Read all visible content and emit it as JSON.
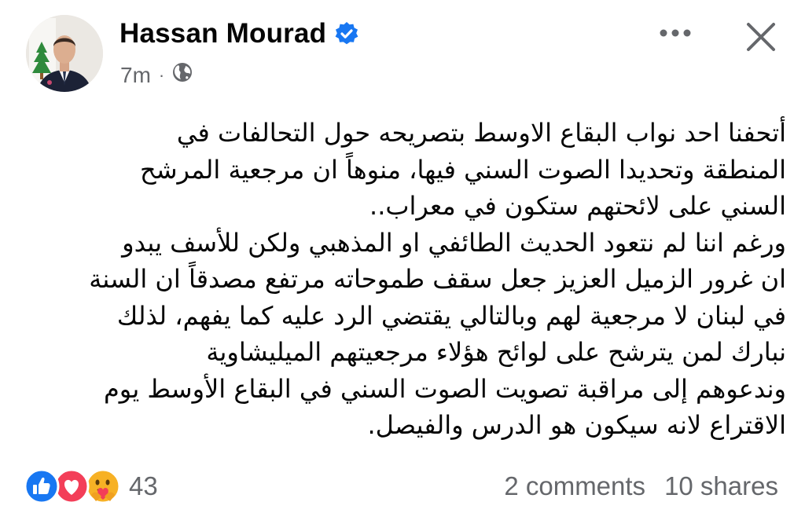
{
  "post": {
    "author": "Hassan Mourad",
    "verified": true,
    "time": "7m",
    "separator": "·",
    "audience_icon": "globe-icon",
    "lines": [
      "أتحفنا احد نواب البقاع الاوسط بتصريحه حول التحالفات في",
      "المنطقة وتحديدا الصوت السني فيها، منوهاً ان مرجعية المرشح",
      "السني على لائحتهم ستكون في معراب..",
      "ورغم اننا لم نتعود الحديث الطائفي او المذهبي ولكن للأسف يبدو",
      "ان غرور الزميل العزيز جعل سقف طموحاته مرتفع مصدقاً ان السنة",
      "في لبنان لا مرجعية لهم وبالتالي يقتضي الرد عليه كما يفهم، لذلك",
      "نبارك لمن يترشح على لوائح هؤلاء مرجعيتهم الميليشاوية",
      "وندعوهم إلى مراقبة تصويت الصوت السني في البقاع الأوسط يوم",
      "الاقتراع لانه سيكون هو الدرس والفيصل."
    ]
  },
  "footer": {
    "reaction_icons": [
      "like-icon",
      "love-icon",
      "care-icon"
    ],
    "reaction_count": "43",
    "comments": "2 comments",
    "shares": "10 shares"
  },
  "colors": {
    "blue": "#1877f2",
    "love": "#f33e58",
    "care": "#f7b125",
    "secondary_text": "#65676b"
  }
}
